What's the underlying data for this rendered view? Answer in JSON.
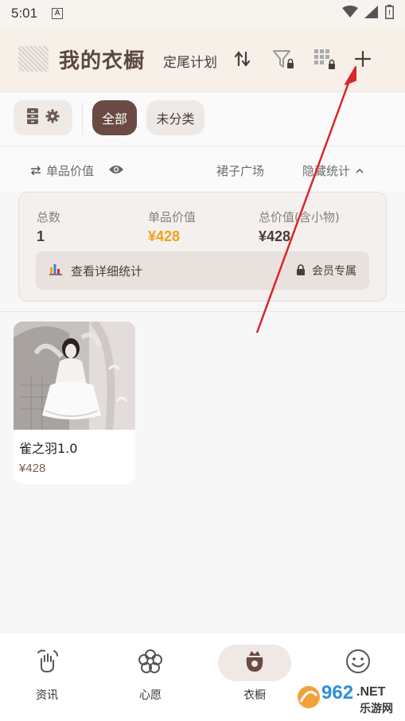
{
  "status_bar": {
    "time": "5:01",
    "a_glyph": "A"
  },
  "header": {
    "title": "我的衣橱",
    "plan_link": "定尾计划",
    "icons": [
      "sort-icon",
      "filter-locked-icon",
      "grid-locked-icon",
      "add-icon"
    ]
  },
  "filters": {
    "all": "全部",
    "uncategorized": "未分类"
  },
  "stats_row": {
    "unit_price": "单品价值",
    "square": "裙子广场",
    "hide_stats": "隐藏统计"
  },
  "summary": {
    "total_count_label": "总数",
    "total_count_value": "1",
    "unit_price_label": "单品价值",
    "unit_price_value": "¥428",
    "total_value_label": "总价值(含小物)",
    "total_value_value": "¥428",
    "detail_link": "查看详细统计",
    "member_only": "会员专属"
  },
  "items": [
    {
      "name": "雀之羽1.0",
      "price": "¥428"
    }
  ],
  "bottom_nav": [
    {
      "label": "资讯",
      "icon": "news-hand-icon"
    },
    {
      "label": "心愿",
      "icon": "flower-icon"
    },
    {
      "label": "衣橱",
      "icon": "wardrobe-bag-icon"
    },
    {
      "label": "",
      "icon": "smile-icon"
    }
  ],
  "watermark": {
    "number": "962",
    "tld": ".NET",
    "cn": "乐游网"
  },
  "colors": {
    "accent_brown": "#6a4a42",
    "price_gold": "#f0a318",
    "header_bg": "#f6f0e9",
    "annotation_red": "#d9262b"
  }
}
